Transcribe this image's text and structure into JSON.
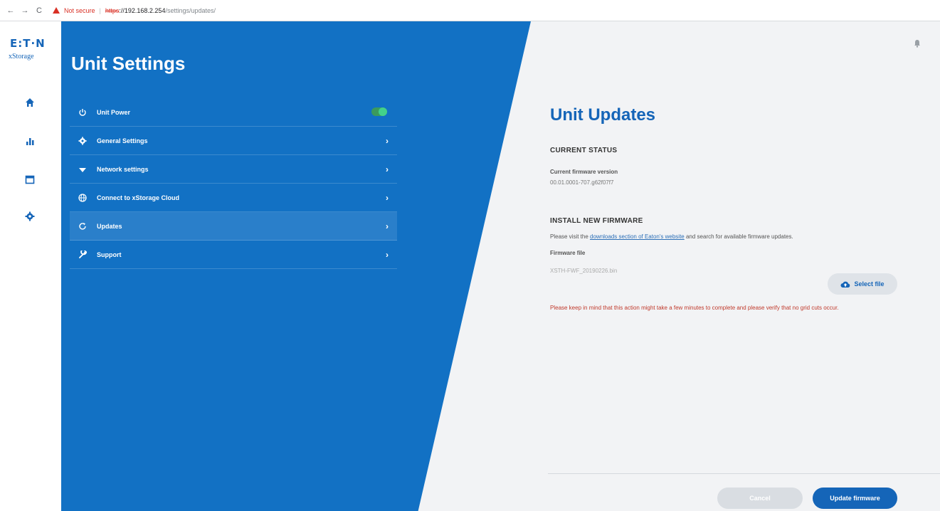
{
  "browser": {
    "back": "←",
    "forward": "→",
    "reload": "C",
    "security_label": "Not secure",
    "separator": "|",
    "url_protocol": "https",
    "url_host": "://192.168.2.254",
    "url_path": "/settings/updates/"
  },
  "rail": {
    "logo": "E:T·N",
    "logo_sub": "xStorage",
    "items": [
      {
        "icon": "home-icon"
      },
      {
        "icon": "bar-chart-icon"
      },
      {
        "icon": "calendar-icon"
      },
      {
        "icon": "gear-icon"
      }
    ]
  },
  "settings": {
    "title": "Unit Settings",
    "menu": [
      {
        "label": "Unit Power",
        "icon": "power-icon",
        "toggle_on": true
      },
      {
        "label": "General Settings",
        "icon": "gear-icon",
        "chevron": "›"
      },
      {
        "label": "Network settings",
        "icon": "wifi-icon",
        "chevron": "›"
      },
      {
        "label": "Connect to xStorage Cloud",
        "icon": "globe-icon",
        "chevron": "›"
      },
      {
        "label": "Updates",
        "icon": "refresh-icon",
        "chevron": "›",
        "active": true
      },
      {
        "label": "Support",
        "icon": "wrench-icon",
        "chevron": "›"
      }
    ]
  },
  "updates": {
    "title": "Unit Updates",
    "current_status_heading": "CURRENT STATUS",
    "current_fw_label": "Current firmware version",
    "current_fw_value": "00.01.0001-707.g62f07f7",
    "install_heading": "INSTALL NEW FIRMWARE",
    "install_desc_prefix": "Please visit the ",
    "install_desc_link": "downloads section of Eaton's website",
    "install_desc_suffix": " and search for available firmware updates.",
    "fw_file_label": "Firmware file",
    "fw_file_value": "XSTH-FWF_20190226.bin",
    "select_file_label": "Select file",
    "warning": "Please keep in mind that this action might take a few minutes to complete and please verify that no grid cuts occur.",
    "cancel_label": "Cancel",
    "update_label": "Update firmware"
  },
  "colors": {
    "brand_blue": "#1271c4",
    "title_blue": "#1565b8",
    "warning_red": "#c0392b",
    "toggle_green": "#43d18a"
  }
}
